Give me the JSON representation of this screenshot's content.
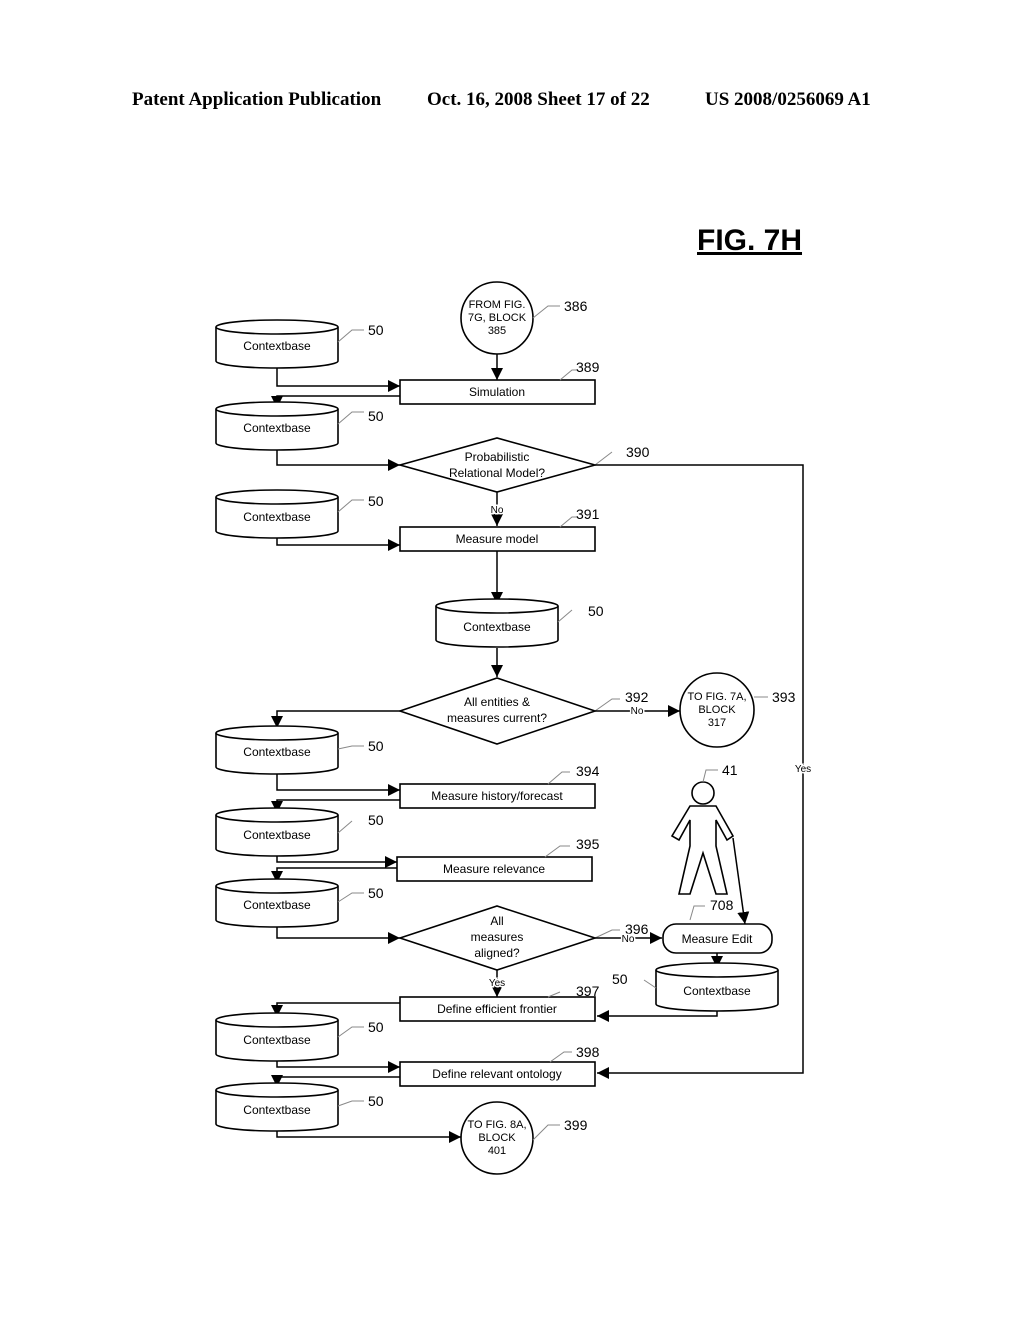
{
  "header": {
    "publication": "Patent Application Publication",
    "date_sheet": "Oct. 16, 2008   Sheet 17 of 22",
    "number": "US 2008/0256069 A1"
  },
  "figure": {
    "title": "FIG. 7H",
    "connectors": {
      "from_386": {
        "lines": [
          "FROM FIG.",
          "7G, BLOCK",
          "385"
        ],
        "ref": "386"
      },
      "to_393": {
        "lines": [
          "TO FIG. 7A,",
          "BLOCK",
          "317"
        ],
        "ref": "393"
      },
      "to_399": {
        "lines": [
          "TO FIG. 8A,",
          "BLOCK",
          "401"
        ],
        "ref": "399"
      }
    },
    "processes": {
      "p389": {
        "label": "Simulation",
        "ref": "389"
      },
      "p391": {
        "label": "Measure model",
        "ref": "391"
      },
      "p394": {
        "label": "Measure history/forecast",
        "ref": "394"
      },
      "p395": {
        "label": "Measure relevance",
        "ref": "395"
      },
      "p397": {
        "label": "Define efficient frontier",
        "ref": "397"
      },
      "p398": {
        "label": "Define relevant ontology",
        "ref": "398"
      },
      "p708": {
        "label": "Measure Edit",
        "ref": "708"
      }
    },
    "decisions": {
      "d390": {
        "lines": [
          "Probabilistic",
          "Relational Model?"
        ],
        "ref": "390"
      },
      "d392": {
        "lines": [
          "All  entities &",
          "measures current?"
        ],
        "ref": "392"
      },
      "d396": {
        "lines": [
          "All",
          "measures",
          "aligned?"
        ],
        "ref": "396"
      }
    },
    "database": {
      "label": "Contextbase",
      "ref": "50"
    },
    "user": {
      "ref": "41"
    },
    "edge_labels": {
      "no": "No",
      "yes": "Yes"
    }
  }
}
